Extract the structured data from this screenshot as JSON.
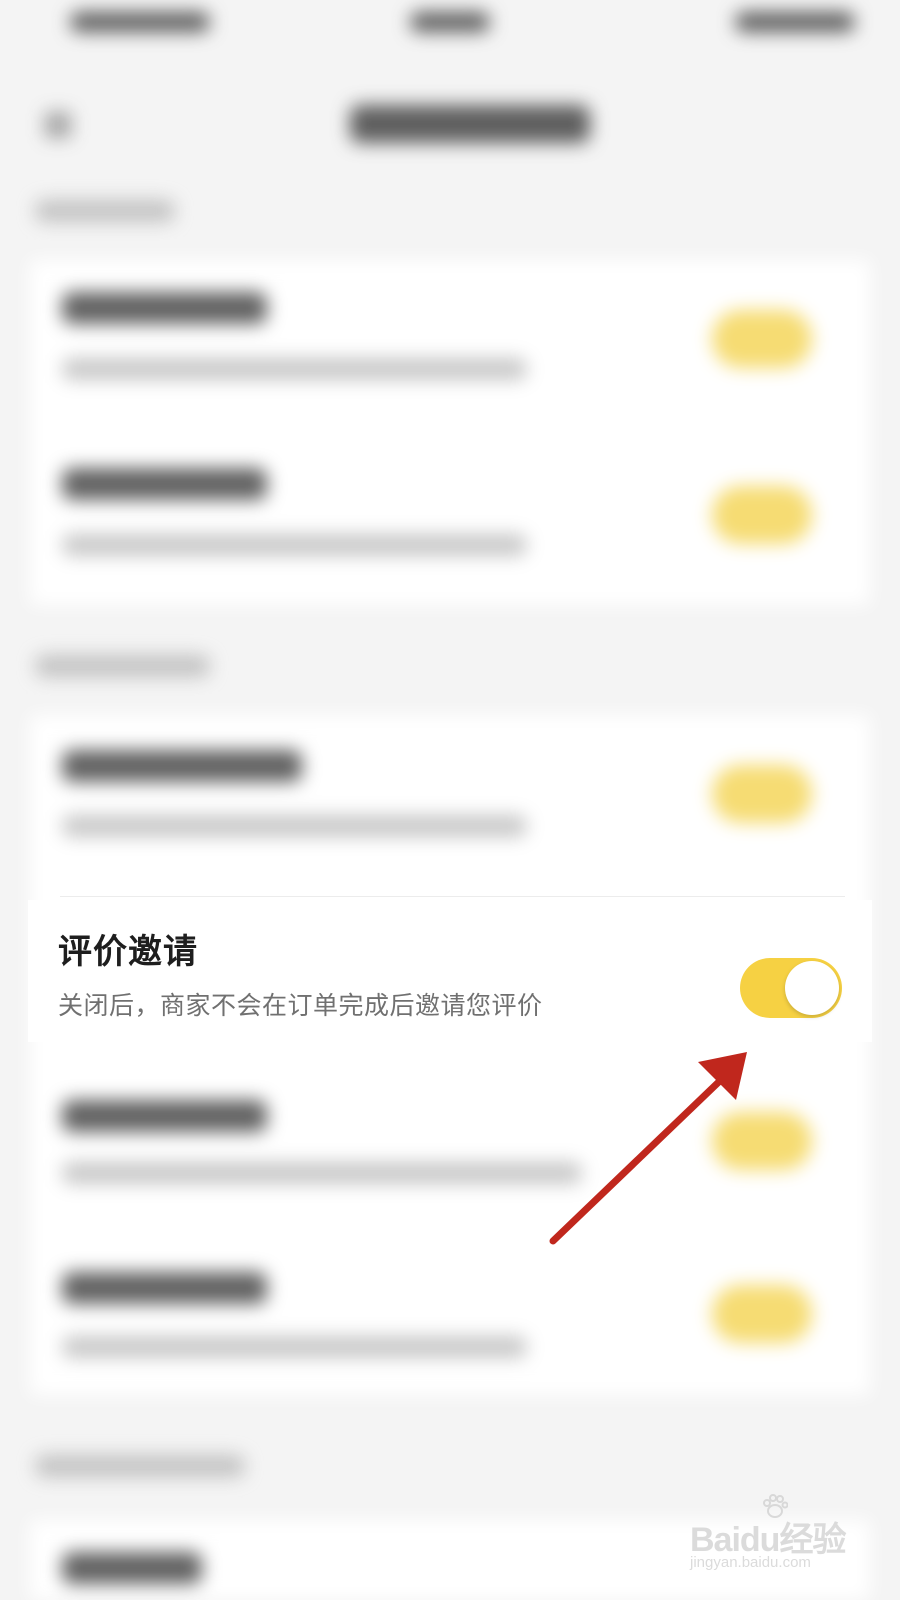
{
  "settings_row": {
    "title": "评价邀请",
    "description": "关闭后，商家不会在订单完成后邀请您评价",
    "toggle_on": true
  },
  "colors": {
    "toggle_on": "#f6d143",
    "annotation_arrow": "#c0271d",
    "background": "#f4f4f4"
  },
  "watermark": {
    "brand": "Baidu经验",
    "url": "jingyan.baidu.com"
  }
}
